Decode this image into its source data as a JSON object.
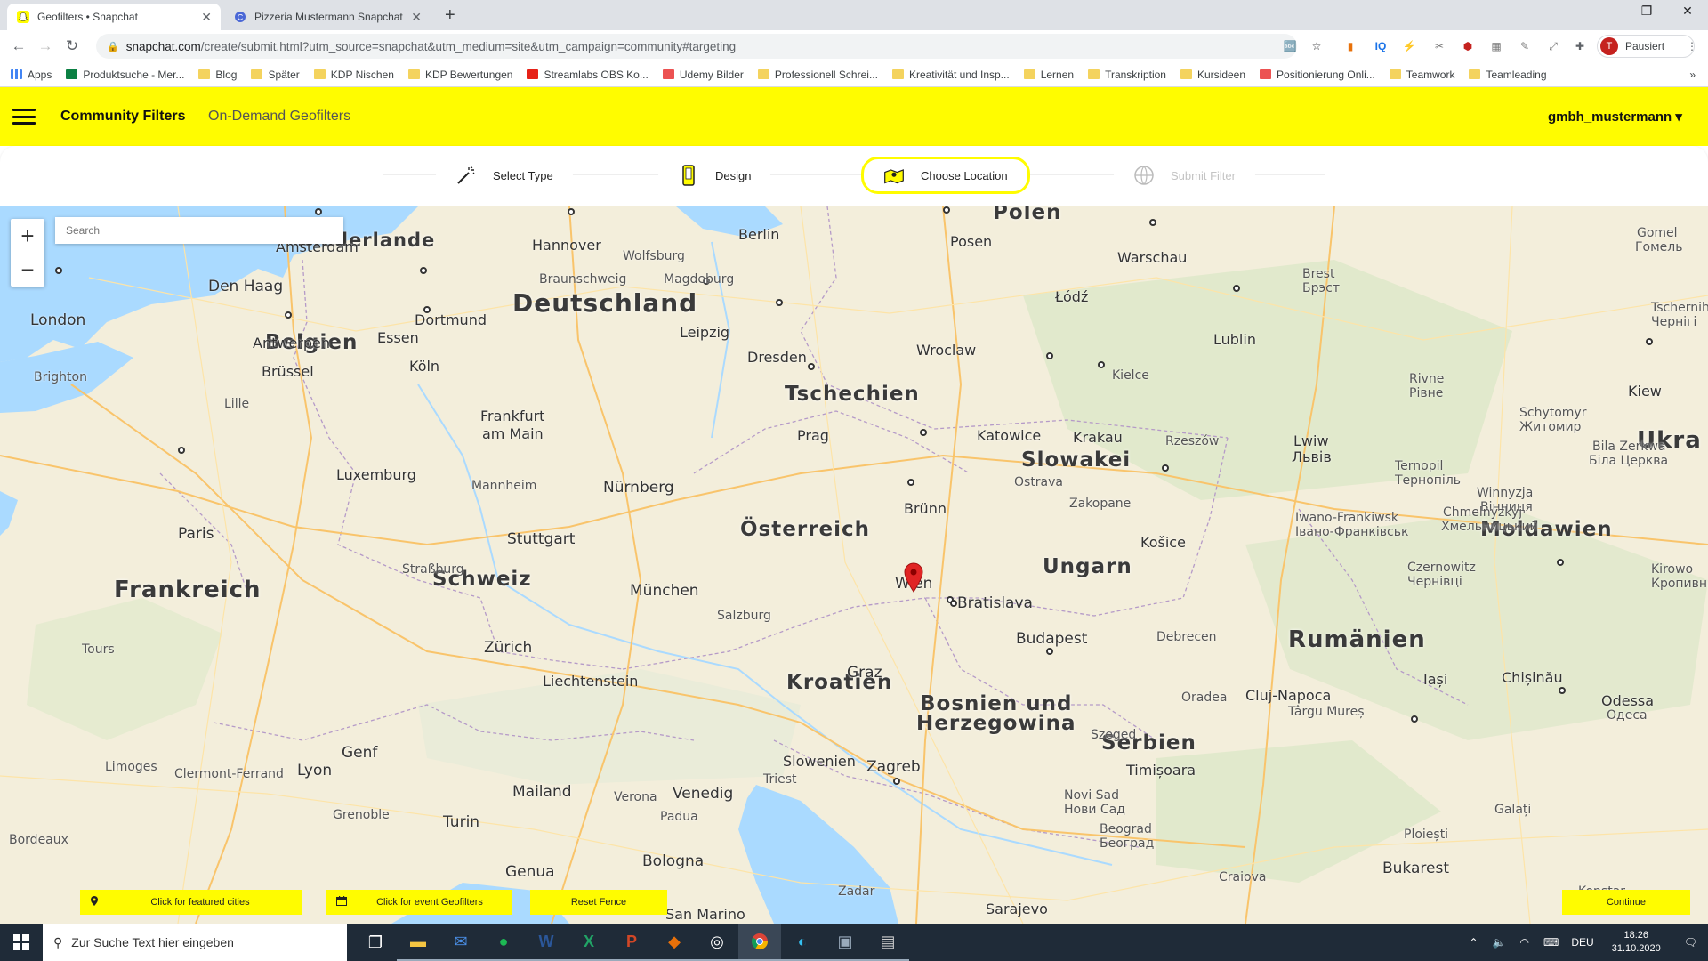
{
  "browser": {
    "tabs": [
      {
        "title": "Geofilters • Snapchat",
        "active": true
      },
      {
        "title": "Pizzeria Mustermann Snapchat G",
        "active": false
      }
    ],
    "url": {
      "host": "snapchat.com",
      "path": "/create/submit.html?utm_source=snapchat&utm_medium=site&utm_campaign=community#targeting"
    },
    "profile_label": "Pausiert",
    "profile_initial": "T",
    "bookmarks": [
      "Apps",
      "Produktsuche - Mer...",
      "Blog",
      "Später",
      "KDP Nischen",
      "KDP Bewertungen",
      "Streamlabs OBS Ko...",
      "Udemy Bilder",
      "Professionell Schrei...",
      "Kreativität und Insp...",
      "Lernen",
      "Transkription",
      "Kursideen",
      "Positionierung Onli...",
      "Teamwork",
      "Teamleading"
    ]
  },
  "header": {
    "nav_community": "Community Filters",
    "nav_ondemand": "On-Demand Geofilters",
    "username": "gmbh_mustermann ▾"
  },
  "steps": [
    "Select Type",
    "Design",
    "Choose Location",
    "Submit Filter"
  ],
  "map": {
    "search_placeholder": "Search",
    "zoom_in": "+",
    "zoom_out": "−",
    "countries": [
      "Polen",
      "Niederlande",
      "Deutschland",
      "Belgien",
      "Tschechien",
      "Slowakei",
      "Österreich",
      "Schweiz",
      "Frankreich",
      "Ungarn",
      "Moldawien",
      "Rumänien",
      "Kroatien",
      "Bosnien und",
      "Herzegowina",
      "Serbien",
      "Ukra"
    ],
    "cities": [
      "Hannover",
      "Berlin",
      "Posen",
      "Warschau",
      "Amsterdam",
      "Wolfsburg",
      "Braunschweig",
      "Magdeburg",
      "Den Haag",
      "Dortmund",
      "Łódź",
      "Brest",
      "Брэст",
      "Gomel",
      "Гомель",
      "London",
      "Essen",
      "Leipzig",
      "Antwerpen",
      "Dresden",
      "Wroclaw",
      "Lublin",
      "Tschernih",
      "Чернігі",
      "Brüssel",
      "Köln",
      "Brighton",
      "Kielce",
      "Rivne",
      "Рівне",
      "Kiew",
      "Lille",
      "Frankfurt",
      "am Main",
      "Prag",
      "Katowice",
      "Krakau",
      "Rzeszów",
      "Lwiw",
      "Львів",
      "Schytomyr",
      "Житомир",
      "Luxemburg",
      "Mannheim",
      "Nürnberg",
      "Ostrava",
      "Ternopil",
      "Тернопіль",
      "Bila Zerkwa",
      "Біла Церква",
      "Brünn",
      "Zakopane",
      "Winnyzja",
      "Вінниця",
      "Paris",
      "Stuttgart",
      "Košice",
      "Iwano-Frankiwsk",
      "Івано-Франківськ",
      "Chmelnyzkyj",
      "Хмельницький",
      "Straßburg",
      "München",
      "Wien",
      "Bratislava",
      "Czernowitz",
      "Чернівці",
      "Kirowo",
      "Кропивни",
      "Salzburg",
      "Tours",
      "Zürich",
      "Budapest",
      "Debrecen",
      "Graz",
      "Liechtenstein",
      "Iași",
      "Chișinău",
      "Cluj-Napoca",
      "Târgu Mureș",
      "Odessa",
      "Одеса",
      "Oradea",
      "Genf",
      "Szeged",
      "Limoges",
      "Clermont-Ferrand",
      "Lyon",
      "Slowenien",
      "Zagreb",
      "Triest",
      "Timișoara",
      "Mailand",
      "Venedig",
      "Verona",
      "Novi Sad",
      "Нови Сад",
      "Galați",
      "Grenoble",
      "Padua",
      "Turin",
      "Beograd",
      "Београд",
      "Bordeaux",
      "Ploiești",
      "Genua",
      "Bologna",
      "Craiova",
      "Bukarest",
      "Zadar",
      "Sarajevo",
      "San Marino",
      "Konstar"
    ]
  },
  "bottom_buttons": {
    "featured": "Click for featured cities",
    "event": "Click for event Geofilters",
    "reset": "Reset Fence",
    "continue": "Continue"
  },
  "taskbar": {
    "search_placeholder": "Zur Suche Text hier eingeben",
    "lang": "DEU",
    "time": "18:26",
    "date": "31.10.2020"
  },
  "colors": {
    "snap_yellow": "#fffc00",
    "taskbar": "#1f2b38",
    "marker_red": "#e02424"
  }
}
